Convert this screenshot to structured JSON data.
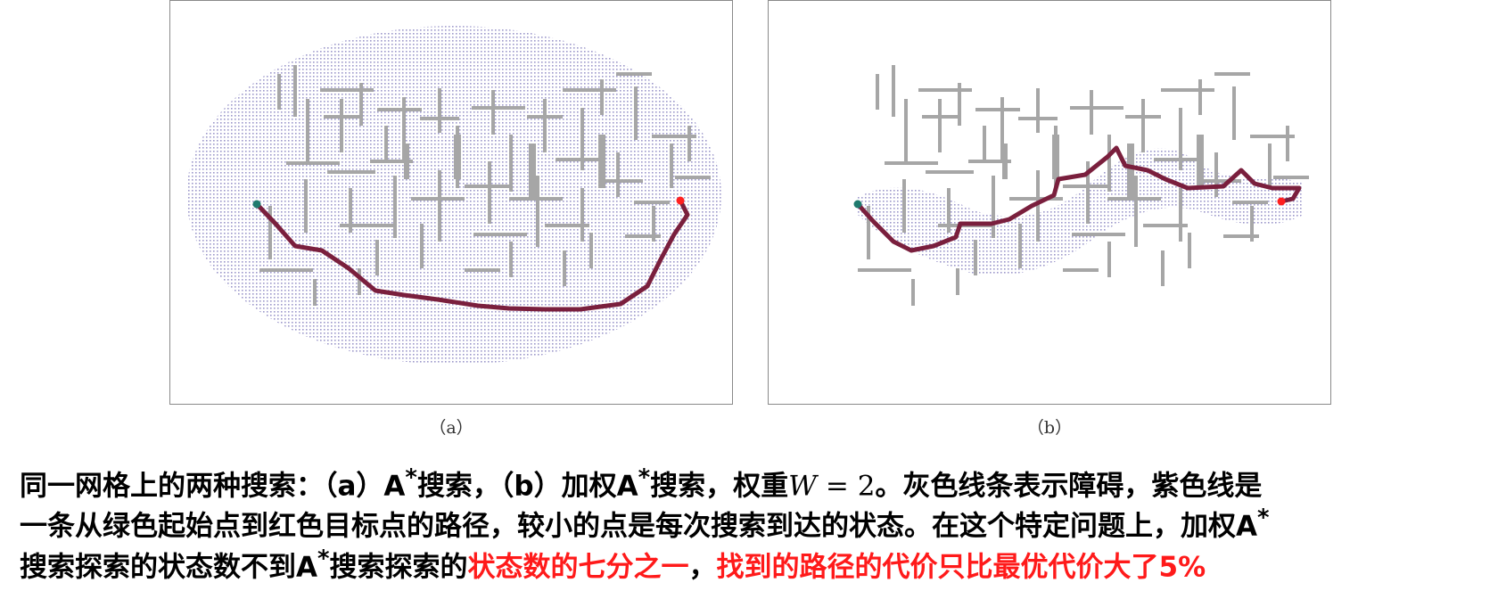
{
  "figure": {
    "panels": [
      {
        "id": "a",
        "label": "（a）",
        "algorithm": "A*",
        "explored_region": "large ellipse"
      },
      {
        "id": "b",
        "label": "（b）",
        "algorithm": "weighted A*",
        "weight": 2,
        "explored_region": "small band"
      }
    ],
    "colors": {
      "obstacle": "#a6a6a6",
      "path": "#7a1f3d",
      "explored_dots": "#8c86c2",
      "start": "#1f7a6e",
      "goal": "#ff2020"
    }
  },
  "caption": {
    "line1_a": "同一网格上的两种搜索：（a）A",
    "line1_sup1": "*",
    "line1_b": "搜索，（b）加权A",
    "line1_sup2": "*",
    "line1_c": "搜索，权重",
    "math_var": "W",
    "math_rest": " = 2",
    "line1_d": "。灰色线条表示障碍，紫色线是",
    "line2_a": "一条从绿色起始点到红色目标点的路径，较小的点是每次搜索到达的状态。在这个特定问题上，加权A",
    "line2_sup": "*",
    "line3_a": "搜索探索的状态数不到A",
    "line3_sup": "*",
    "line3_b": "搜索探索的",
    "line3_red1": "状态数的七分之一",
    "line3_comma": "，",
    "line3_red2": "找到的路径的代价只比最优代价大了5%"
  }
}
